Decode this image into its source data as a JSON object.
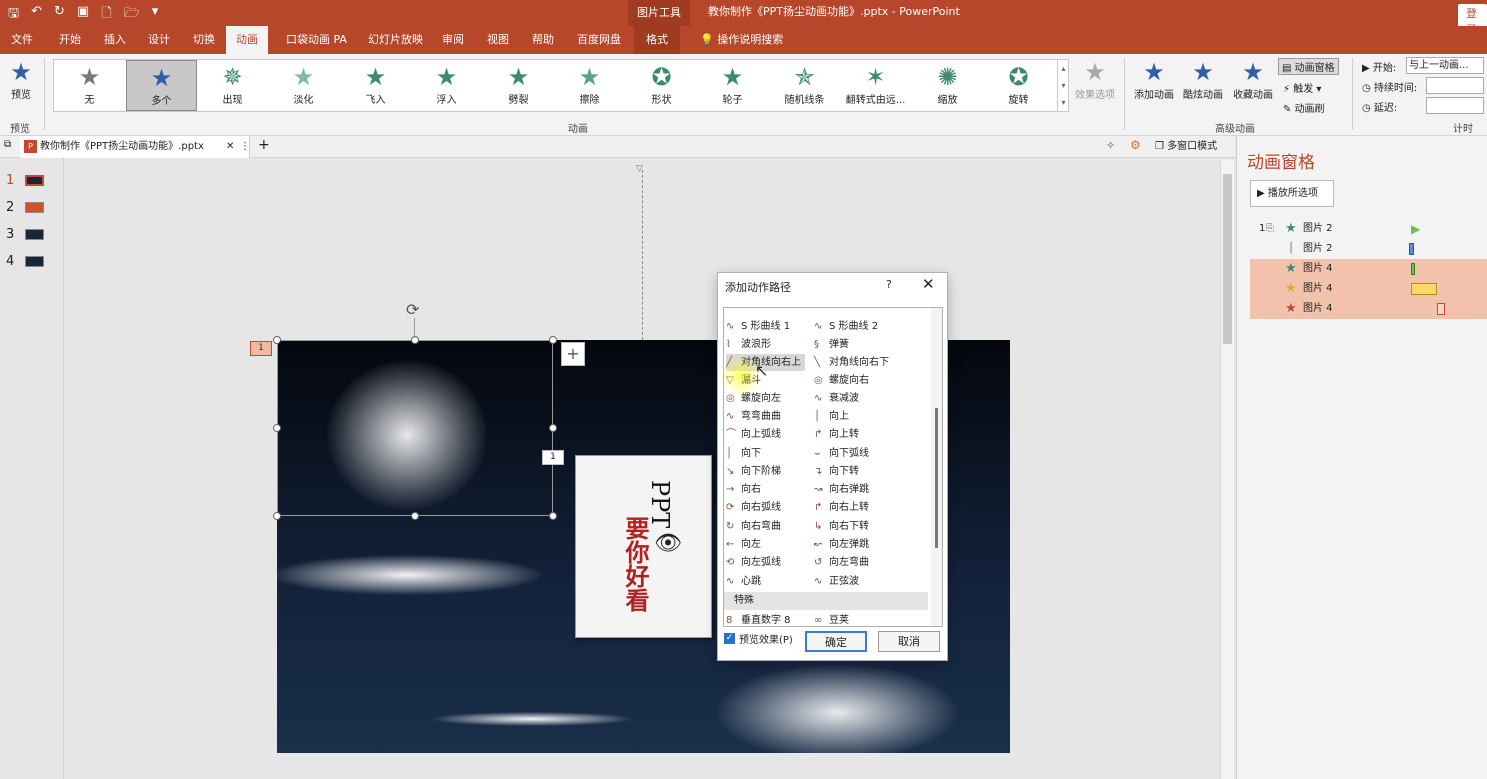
{
  "titlebar": {
    "context_tool": "图片工具",
    "doc_title": "教你制作《PPT扬尘动画功能》.pptx  -  PowerPoint",
    "login": "登录"
  },
  "tabs": [
    {
      "label": "文件"
    },
    {
      "label": "开始"
    },
    {
      "label": "插入"
    },
    {
      "label": "设计"
    },
    {
      "label": "切换"
    },
    {
      "label": "动画"
    },
    {
      "label": "口袋动画 PA"
    },
    {
      "label": "幻灯片放映"
    },
    {
      "label": "审阅"
    },
    {
      "label": "视图"
    },
    {
      "label": "帮助"
    },
    {
      "label": "百度网盘"
    },
    {
      "label": "格式"
    },
    {
      "label": "操作说明搜索"
    }
  ],
  "ribbon": {
    "preview_label": "预览",
    "preview_group": "预览",
    "animation_group": "动画",
    "gallery": [
      {
        "label": "无",
        "color": "#7a7a7a"
      },
      {
        "label": "多个",
        "color": "#2f5fa8"
      },
      {
        "label": "出现",
        "color": "#3d8a6e"
      },
      {
        "label": "淡化",
        "color": "#7fb9a0"
      },
      {
        "label": "飞入",
        "color": "#3d8a6e"
      },
      {
        "label": "浮入",
        "color": "#3d8a6e"
      },
      {
        "label": "劈裂",
        "color": "#3d8a6e"
      },
      {
        "label": "擦除",
        "color": "#5aa386"
      },
      {
        "label": "形状",
        "color": "#3d8a6e"
      },
      {
        "label": "轮子",
        "color": "#3d8a6e"
      },
      {
        "label": "随机线条",
        "color": "#3d8a6e"
      },
      {
        "label": "翻转式由远...",
        "color": "#3d8a6e"
      },
      {
        "label": "缩放",
        "color": "#3d8a6e"
      },
      {
        "label": "旋转",
        "color": "#3d8a6e"
      }
    ],
    "effect_options": "效果选项",
    "advanced_group": "高级动画",
    "add_animation": "添加动画",
    "cool_animation": "酷炫动画",
    "fav_animation": "收藏动画",
    "anim_pane": "动画窗格",
    "trigger": "触发",
    "anim_brush": "动画刷",
    "timing_group": "计时",
    "start_label": "开始:",
    "start_value": "与上一动画...",
    "duration_label": "持续时间:",
    "delay_label": "延迟:"
  },
  "doctab": {
    "name": "教你制作《PPT扬尘动画功能》.pptx",
    "multi_window": "多窗口模式"
  },
  "thumbnails": [
    {
      "num": "1"
    },
    {
      "num": "2"
    },
    {
      "num": "3"
    },
    {
      "num": "4"
    }
  ],
  "slide": {
    "anim_tag": "1",
    "anim_tag2": "1",
    "plus": "+"
  },
  "book": {
    "title": "PPT",
    "subtitle": "要你好看"
  },
  "dialog": {
    "title": "添加动作路径",
    "help": "?",
    "close": "✕",
    "left_items": [
      {
        "icon": "∿",
        "label": "S 形曲线 1"
      },
      {
        "icon": "⌇",
        "label": "波浪形"
      },
      {
        "icon": "╱",
        "label": "对角线向右上"
      },
      {
        "icon": "▽",
        "label": "漏斗"
      },
      {
        "icon": "◎",
        "label": "螺旋向左"
      },
      {
        "icon": "∿",
        "label": "弯弯曲曲"
      },
      {
        "icon": "⌒",
        "label": "向上弧线"
      },
      {
        "icon": "│",
        "label": "向下"
      },
      {
        "icon": "↘",
        "label": "向下阶梯"
      },
      {
        "icon": "→",
        "label": "向右"
      },
      {
        "icon": "⟳",
        "label": "向右弧线"
      },
      {
        "icon": "↻",
        "label": "向右弯曲"
      },
      {
        "icon": "←",
        "label": "向左"
      },
      {
        "icon": "⟲",
        "label": "向左弧线"
      },
      {
        "icon": "∿",
        "label": "心跳"
      }
    ],
    "right_items": [
      {
        "icon": "∿",
        "label": "S 形曲线 2"
      },
      {
        "icon": "§",
        "label": "弹簧"
      },
      {
        "icon": "╲",
        "label": "对角线向右下"
      },
      {
        "icon": "◎",
        "label": "螺旋向右"
      },
      {
        "icon": "∿",
        "label": "衰减波"
      },
      {
        "icon": "│",
        "label": "向上"
      },
      {
        "icon": "↱",
        "label": "向上转"
      },
      {
        "icon": "⌣",
        "label": "向下弧线"
      },
      {
        "icon": "↴",
        "label": "向下转"
      },
      {
        "icon": "↝",
        "label": "向右弹跳"
      },
      {
        "icon": "↱",
        "label": "向右上转"
      },
      {
        "icon": "↳",
        "label": "向右下转"
      },
      {
        "icon": "↜",
        "label": "向左弹跳"
      },
      {
        "icon": "↺",
        "label": "向左弯曲"
      },
      {
        "icon": "∿",
        "label": "正弦波"
      }
    ],
    "special_section": "特殊",
    "special_left": {
      "icon": "8",
      "label": "垂直数字 8"
    },
    "special_right": {
      "icon": "∞",
      "label": "豆荚"
    },
    "preview_effect": "预览效果(P)",
    "ok": "确定",
    "cancel": "取消"
  },
  "pane": {
    "title": "动画窗格",
    "play": "播放所选项",
    "rows": [
      {
        "index": "1",
        "name": "图片 2",
        "star_color": "#3d8a6e",
        "bar_color": "#6cc24a",
        "highlight": false
      },
      {
        "index": "",
        "name": "图片 2",
        "star_color": "#8a4a30",
        "bar_color": "#5b8fd1",
        "highlight": false
      },
      {
        "index": "",
        "name": "图片 4",
        "star_color": "#3d8a6e",
        "bar_color": "#6cc24a",
        "highlight": true
      },
      {
        "index": "",
        "name": "图片 4",
        "star_color": "#e0a72a",
        "bar_color": "#ffd966",
        "highlight": true
      },
      {
        "index": "",
        "name": "图片 4",
        "star_color": "#d0402a",
        "bar_color": "#f2c2ad",
        "highlight": true
      }
    ]
  }
}
